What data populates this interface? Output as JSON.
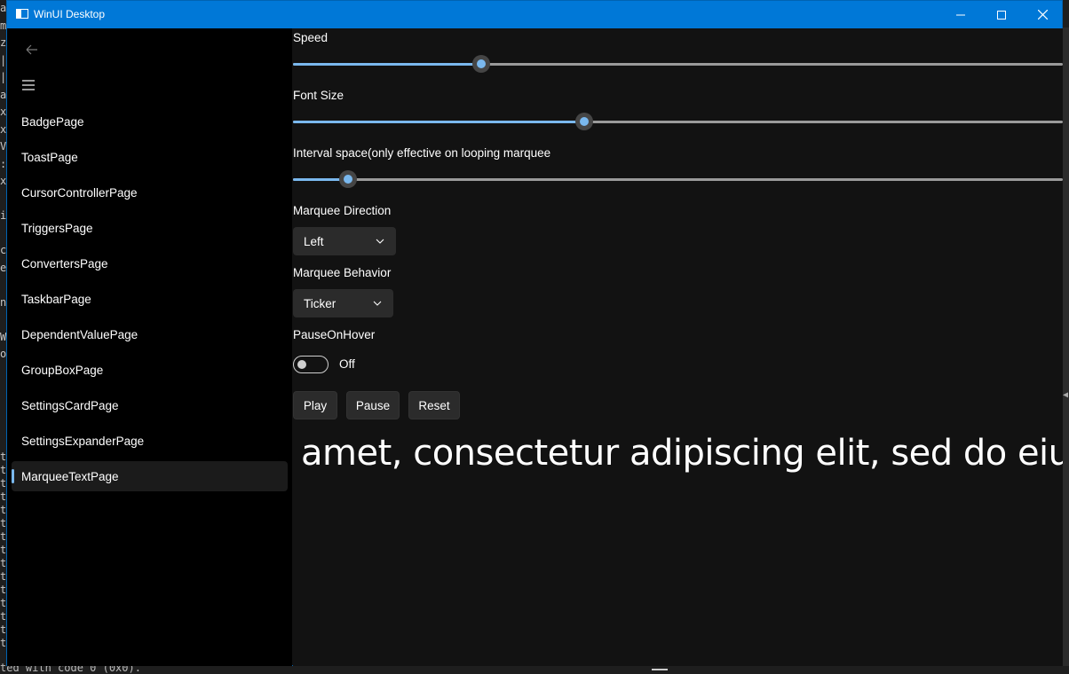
{
  "window": {
    "title": "WinUI Desktop"
  },
  "nav": {
    "items": [
      {
        "label": "BadgePage"
      },
      {
        "label": "ToastPage"
      },
      {
        "label": "CursorControllerPage"
      },
      {
        "label": "TriggersPage"
      },
      {
        "label": "ConvertersPage"
      },
      {
        "label": "TaskbarPage"
      },
      {
        "label": "DependentValuePage"
      },
      {
        "label": "GroupBoxPage"
      },
      {
        "label": "SettingsCardPage"
      },
      {
        "label": "SettingsExpanderPage"
      },
      {
        "label": "MarqueeTextPage"
      }
    ],
    "selected": "MarqueeTextPage"
  },
  "controls": {
    "speed": {
      "label": "Speed",
      "fraction": 0.245
    },
    "font_size": {
      "label": "Font Size",
      "fraction": 0.378
    },
    "interval": {
      "label": "Interval space(only effective on looping marquee",
      "fraction": 0.071
    },
    "direction": {
      "label": "Marquee Direction",
      "value": "Left"
    },
    "behavior": {
      "label": "Marquee Behavior",
      "value": "Ticker"
    },
    "pause_on_hover": {
      "label": "PauseOnHover",
      "state_text": "Off",
      "on": false
    }
  },
  "buttons": {
    "play": "Play",
    "pause": "Pause",
    "reset": "Reset"
  },
  "marquee": {
    "text": "amet, consectetur adipiscing elit, sed do eiusmod"
  },
  "background_console": {
    "left_chars": [
      "a",
      "m",
      "z",
      "|",
      "|",
      "a",
      "x",
      "x",
      "V",
      ":",
      "x",
      "",
      "i",
      "",
      "c",
      "e",
      "",
      "n",
      "",
      "W",
      "o"
    ],
    "tail_chars": [
      "t",
      "t",
      "t",
      "t",
      "t",
      "t",
      "t",
      "t",
      "t",
      "t",
      "t",
      "t",
      "t",
      "t",
      "t"
    ],
    "bottom_text": "ted with code 0 (0x0)."
  },
  "colors": {
    "accent": "#7ab8ee",
    "titlebar": "#0078d7"
  }
}
